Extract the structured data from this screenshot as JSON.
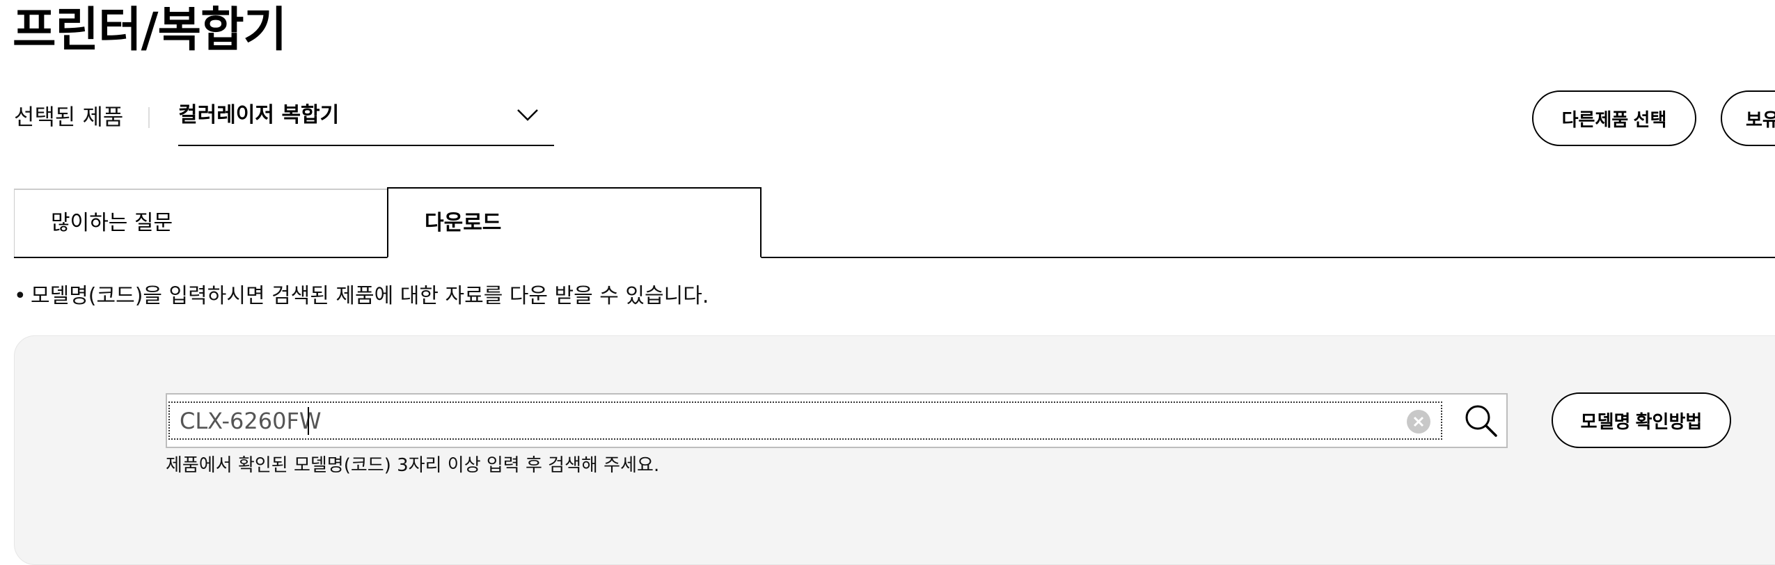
{
  "page": {
    "title": "프린터/복합기"
  },
  "selector": {
    "label": "선택된 제품",
    "selected_value": "컬러레이저 복합기",
    "chevron_icon": "chevron-down-icon"
  },
  "actions": {
    "other_product_label": "다른제품 선택",
    "owned_product_label": "보유"
  },
  "tabs": [
    {
      "label": "많이하는 질문",
      "active": false
    },
    {
      "label": "다운로드",
      "active": true
    }
  ],
  "notice": {
    "bullet": "•",
    "text": "모델명(코드)을 입력하시면 검색된 제품에 대한 자료를 다운 받을 수 있습니다."
  },
  "search": {
    "value": "CLX-6260FW",
    "placeholder": "",
    "clear_icon": "clear-circle-icon",
    "search_icon": "search-icon",
    "hint": "제품에서 확인된 모델명(코드) 3자리 이상 입력 후 검색해 주세요.",
    "model_help_label": "모델명 확인방법"
  },
  "colors": {
    "text": "#000000",
    "panel_bg": "#f4f4f4",
    "input_border": "#bdbdbd",
    "clear_icon_bg": "#c8c8c8"
  }
}
